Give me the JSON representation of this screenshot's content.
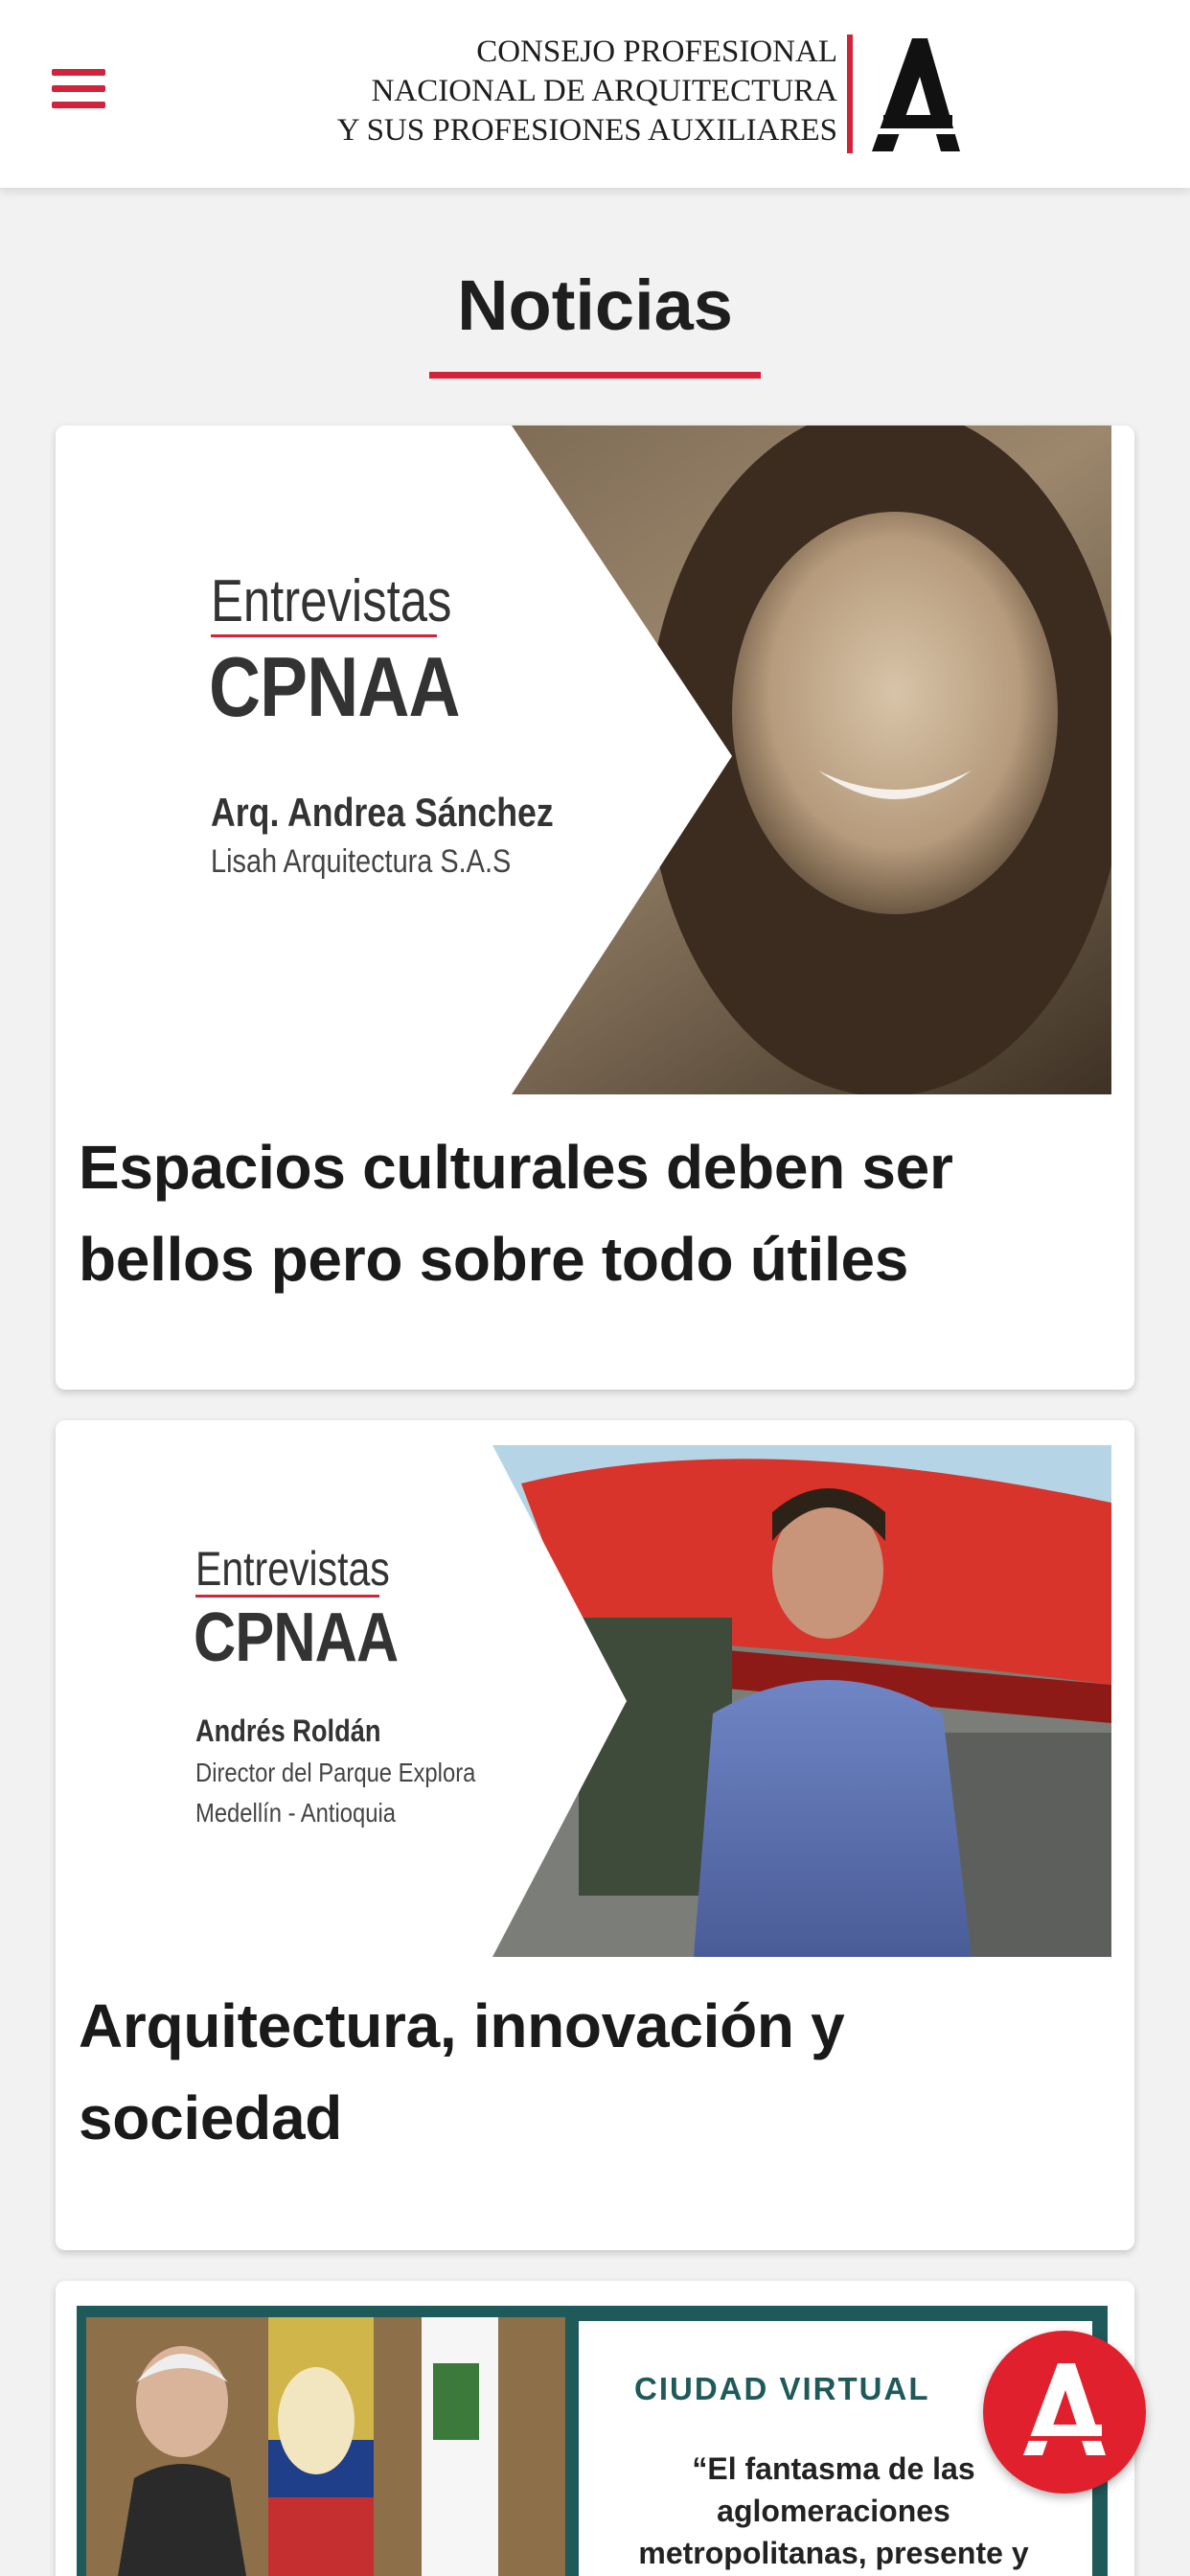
{
  "header": {
    "org_line1": "CONSEJO PROFESIONAL",
    "org_line2": "NACIONAL DE ARQUITECTURA",
    "org_line3": "Y SUS PROFESIONES AUXILIARES",
    "logo_letter": "A"
  },
  "section": {
    "title": "Noticias"
  },
  "articles": [
    {
      "kicker": "Entrevistas",
      "brand": "CPNAA",
      "person": "Arq. Andrea Sánchez",
      "affiliation": "Lisah Arquitectura S.A.S",
      "title": "Espacios culturales deben ser bellos pero sobre todo útiles"
    },
    {
      "kicker": "Entrevistas",
      "brand": "CPNAA",
      "person": "Andrés Roldán",
      "affiliation_line1": "Director del Parque Explora",
      "affiliation_line2": "Medellín - Antioquia",
      "title": "Arquitectura, innovación y sociedad"
    },
    {
      "kicker": "CIUDAD VIRTUAL",
      "quote_line1": "“El fantasma de las",
      "quote_line2": "aglomeraciones",
      "quote_line3": "metropolitanas, presente y"
    }
  ],
  "colors": {
    "accent": "#d2233a",
    "fab": "#e0212d",
    "teal_frame": "#1f5a5a"
  }
}
